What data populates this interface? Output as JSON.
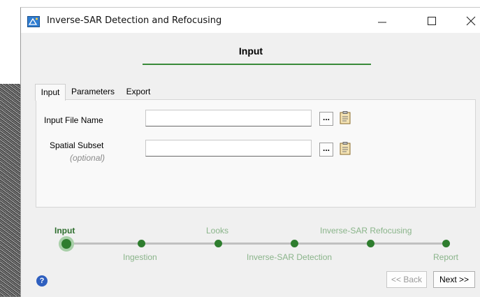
{
  "window": {
    "title": "Inverse-SAR Detection and Refocusing",
    "controls": {
      "minimize_icon": "minimize-icon",
      "maximize_icon": "maximize-icon",
      "close_icon": "close-icon"
    }
  },
  "header": {
    "title": "Input"
  },
  "tabs": [
    {
      "label": "Input",
      "active": true
    },
    {
      "label": "Parameters",
      "active": false
    },
    {
      "label": "Export",
      "active": false
    }
  ],
  "form": {
    "input_file": {
      "label": "Input File Name",
      "value": "",
      "browse_label": "..."
    },
    "spatial_subset": {
      "label": "Spatial Subset",
      "note": "(optional)",
      "value": "",
      "browse_label": "..."
    }
  },
  "steps": [
    {
      "label": "Input",
      "current": true
    },
    {
      "label": "Ingestion",
      "current": false
    },
    {
      "label": "Looks",
      "current": false
    },
    {
      "label": "Inverse-SAR Detection",
      "current": false
    },
    {
      "label": "Inverse-SAR Refocusing",
      "current": false
    },
    {
      "label": "Report",
      "current": false
    }
  ],
  "footer": {
    "help": "?",
    "back_label": "<< Back",
    "next_label": "Next >>"
  },
  "colors": {
    "accent": "#2e7d2e",
    "step_label": "#8ab48a",
    "help": "#2f5fbf"
  }
}
